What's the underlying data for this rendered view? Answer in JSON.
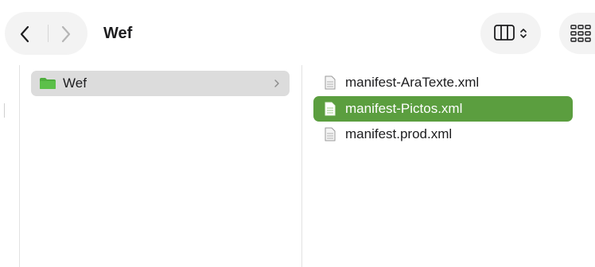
{
  "toolbar": {
    "title": "Wef",
    "back_icon": "chevron-left-icon",
    "forward_icon": "chevron-right-icon",
    "view_icon": "column-view-icon",
    "view_menu_icon": "chevron-updown-icon",
    "group_icon": "grid-view-icon"
  },
  "column1": {
    "items": [
      {
        "label": "Wef",
        "icon": "folder-icon",
        "selected": true
      }
    ]
  },
  "column2": {
    "items": [
      {
        "label": "manifest-AraTexte.xml",
        "icon": "document-icon",
        "selected": false
      },
      {
        "label": "manifest-Pictos.xml",
        "icon": "document-icon",
        "selected": true
      },
      {
        "label": "manifest.prod.xml",
        "icon": "document-icon",
        "selected": false
      }
    ]
  },
  "colors": {
    "selection_accent": "#5b9e3f",
    "inactive_selection": "#dcdcdc",
    "folder": "#4fae3e"
  }
}
